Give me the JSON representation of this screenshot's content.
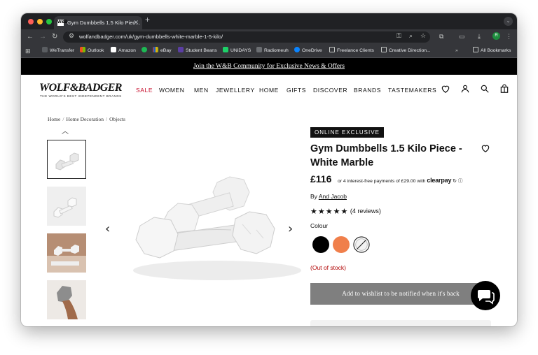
{
  "browser": {
    "tab_title": "Gym Dumbbells 1.5 Kilo Piec…",
    "tab_favicon": "W&B",
    "url": "wolfandbadger.com/uk/gym-dumbbells-white-marble-1-5-kilo/",
    "profile_initial": "R",
    "bookmarks": [
      "WeTransfer",
      "Outlook",
      "Amazon",
      "eBay",
      "Student Beans",
      "UNiDAYS",
      "Radiomeuh",
      "OneDrive",
      "Freelance Clients",
      "Creative Direction..."
    ],
    "all_bookmarks": "All Bookmarks"
  },
  "site": {
    "banner": "Join the W&B Community for Exclusive News & Offers",
    "logo": "WOLF&BADGER",
    "tagline": "THE WORLD'S BEST INDEPENDENT BRANDS",
    "nav": [
      "SALE",
      "WOMEN",
      "MEN",
      "JEWELLERY",
      "HOME",
      "GIFTS",
      "DISCOVER",
      "BRANDS",
      "TASTEMAKERS"
    ],
    "accent_color": "#c8102e"
  },
  "breadcrumb": [
    "Home",
    "Home Decoration",
    "Objects"
  ],
  "product": {
    "badge": "ONLINE EXCLUSIVE",
    "title": "Gym Dumbbells 1.5 Kilo Piece - White Marble",
    "price": "£116",
    "clearpay_text": "or 4 interest-free payments of £29.00 with",
    "clearpay_brand": "clearpay",
    "by_label": "By",
    "brand": "And Jacob",
    "rating": 5,
    "stars": "★★★★★",
    "reviews": "(4 reviews)",
    "colour_label": "Colour",
    "colours": [
      "#000000",
      "#f07f4b",
      "white-marble"
    ],
    "stock_status": "(Out of stock)",
    "wishlist_button": "Add to wishlist to be notified when it's back"
  }
}
